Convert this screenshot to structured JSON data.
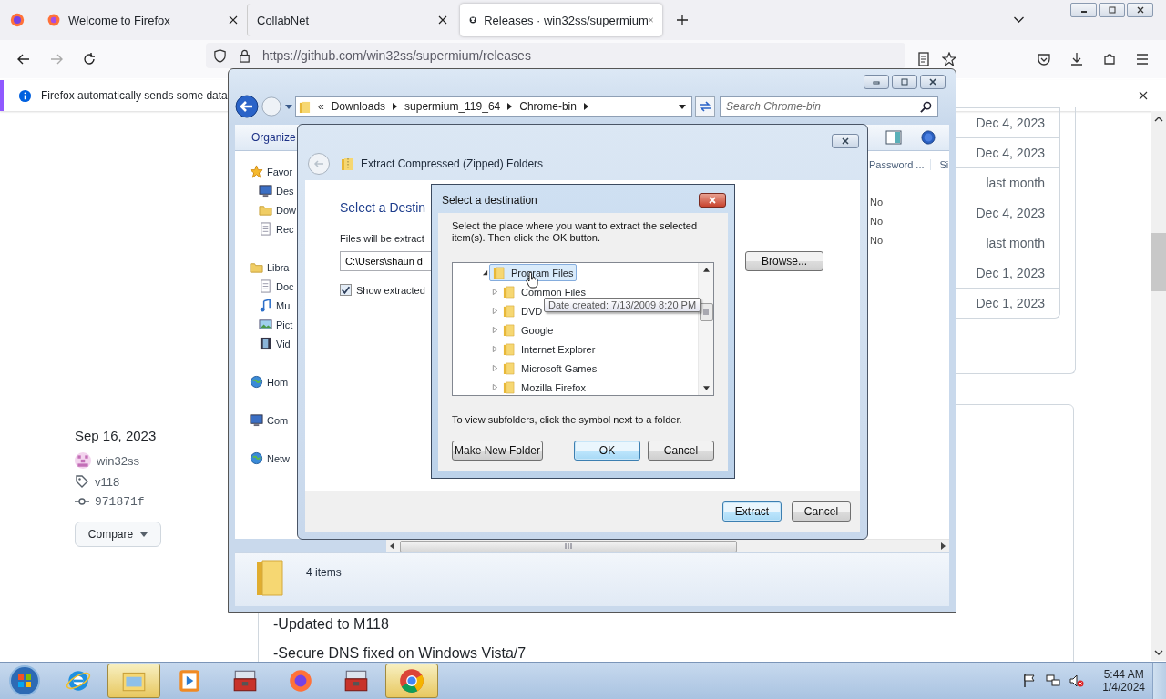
{
  "browser": {
    "tabs": [
      {
        "title": "Welcome to Firefox",
        "kind": "firefox",
        "selected": false
      },
      {
        "title": "CollabNet",
        "kind": "plain",
        "selected": false
      },
      {
        "title": "Releases · win32ss/supermium",
        "kind": "github",
        "selected": true
      }
    ],
    "url": "https://github.com/win32ss/supermium/releases",
    "notice": "Firefox automatically sends some data"
  },
  "page": {
    "dates": [
      "Dec 4, 2023",
      "Dec 4, 2023",
      "last month",
      "Dec 4, 2023",
      "last month",
      "Dec 1, 2023",
      "Dec 1, 2023"
    ],
    "release": {
      "date": "Sep 16, 2023",
      "author": "win32ss",
      "tag": "v118",
      "commit": "971871f",
      "compare": "Compare"
    },
    "notes": [
      "-Updated to M118",
      "-Secure DNS fixed on Windows Vista/7"
    ]
  },
  "explorer": {
    "breadcrumb_prefix": "«",
    "breadcrumb": [
      "Downloads",
      "supermium_119_64",
      "Chrome-bin"
    ],
    "search_placeholder": "Search Chrome-bin",
    "organize": "Organize",
    "nav": [
      {
        "label": "Favor",
        "kind": "star",
        "children": [
          {
            "label": "Des",
            "kind": "monitor"
          },
          {
            "label": "Dow",
            "kind": "folder"
          },
          {
            "label": "Rec",
            "kind": "page"
          }
        ]
      },
      {
        "label": "Libra",
        "kind": "folder",
        "children": [
          {
            "label": "Doc",
            "kind": "page"
          },
          {
            "label": "Mu",
            "kind": "note"
          },
          {
            "label": "Pict",
            "kind": "photo"
          },
          {
            "label": "Vid",
            "kind": "film"
          }
        ]
      },
      {
        "label": "Hom",
        "kind": "globe"
      },
      {
        "label": "Com",
        "kind": "monitor"
      },
      {
        "label": "Netw",
        "kind": "globe"
      }
    ],
    "columns": [
      "Password ...",
      "Si"
    ],
    "cells": [
      "No",
      "No",
      "No"
    ],
    "status": "4 items"
  },
  "extract": {
    "title": "Extract Compressed (Zipped) Folders",
    "heading": "Select a Destin",
    "files_label": "Files will be extract",
    "path": "C:\\Users\\shaun d",
    "browse": "Browse...",
    "show_extracted": {
      "label": "Show extracted",
      "checked": true
    },
    "buttons": [
      "Extract",
      "Cancel"
    ]
  },
  "select": {
    "title": "Select a destination",
    "instructions": "Select the place where you want to extract the selected item(s).  Then click the OK button.",
    "tree": [
      {
        "label": "Program Files",
        "selected": true,
        "expanded": true,
        "children": [
          {
            "label": "Common Files",
            "selected": false,
            "expanded": false
          },
          {
            "label": "DVD",
            "selected": false,
            "expanded": false
          },
          {
            "label": "Google",
            "selected": false,
            "expanded": false
          },
          {
            "label": "Internet Explorer",
            "selected": false,
            "expanded": false
          },
          {
            "label": "Microsoft Games",
            "selected": false,
            "expanded": false
          },
          {
            "label": "Mozilla Firefox",
            "selected": false,
            "expanded": false
          }
        ]
      }
    ],
    "tooltip": "Date created: 7/13/2009 8:20 PM",
    "hint": "To view subfolders, click the symbol next to a folder.",
    "buttons": [
      "Make New Folder",
      "OK",
      "Cancel"
    ]
  },
  "taskbar": {
    "apps": [
      {
        "kind": "ie",
        "active": false
      },
      {
        "kind": "explorer",
        "active": true
      },
      {
        "kind": "media",
        "active": false
      },
      {
        "kind": "toolbox",
        "active": false
      },
      {
        "kind": "firefox",
        "active": false
      },
      {
        "kind": "toolbox",
        "active": false
      },
      {
        "kind": "chrome",
        "active": true
      }
    ],
    "time": "5:44 AM",
    "date": "1/4/2024"
  }
}
